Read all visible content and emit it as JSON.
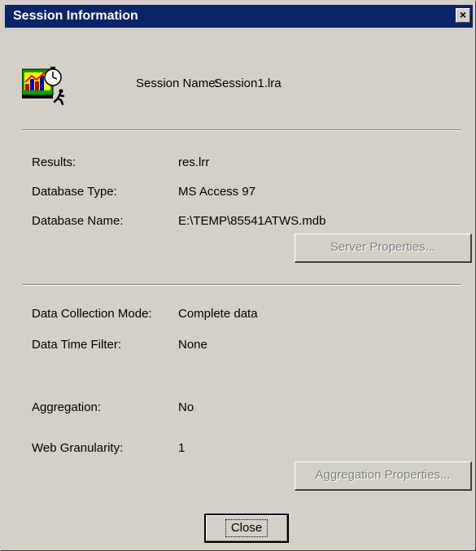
{
  "window": {
    "title": "Session Information",
    "close_glyph": "×"
  },
  "session": {
    "label": "Session Name:",
    "value": "Session1.lra",
    "icon": "analysis-session-icon"
  },
  "fields_top": [
    {
      "label": "Results:",
      "value": "res.lrr"
    },
    {
      "label": "Database Type:",
      "value": "MS Access 97"
    },
    {
      "label": "Database Name:",
      "value": "E:\\TEMP\\85541ATWS.mdb"
    }
  ],
  "server_button": {
    "label": "Server Properties...",
    "enabled": false
  },
  "fields_bottom": [
    {
      "label": "Data Collection Mode:",
      "value": "Complete data"
    },
    {
      "label": "Data Time Filter:",
      "value": "None"
    },
    {
      "label": "Aggregation:",
      "value": "No"
    },
    {
      "label": "Web Granularity:",
      "value": "1"
    }
  ],
  "aggregation_button": {
    "label": "Aggregation Properties...",
    "enabled": false
  },
  "close_button": {
    "label": "Close"
  },
  "colors": {
    "titlebar": "#0a246a",
    "dialog_bg": "#d4d0c8",
    "disabled_text": "#808080"
  }
}
